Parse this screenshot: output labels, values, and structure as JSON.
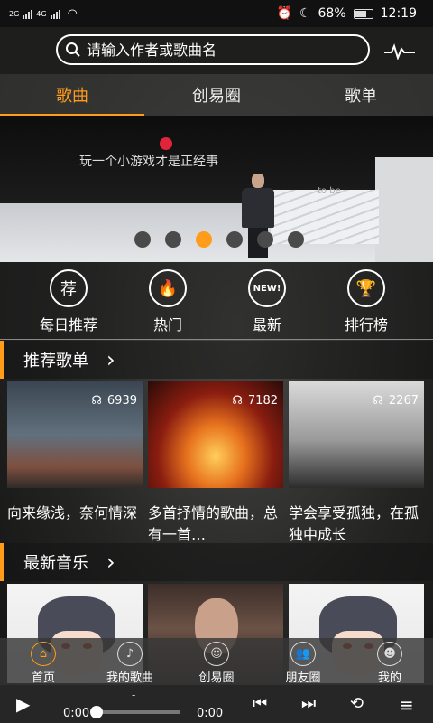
{
  "status": {
    "network_1": "2G",
    "network_2": "4G",
    "battery": "68%",
    "time": "12:19"
  },
  "search": {
    "placeholder": "请输入作者或歌曲名"
  },
  "tabs": [
    {
      "label": "歌曲",
      "active": true
    },
    {
      "label": "创易圈",
      "active": false
    },
    {
      "label": "歌单",
      "active": false
    }
  ],
  "banner": {
    "slogan": "玩一个小游戏才是正经事",
    "brand": "to be",
    "active_page": 3,
    "page_count": 6
  },
  "quick_actions": [
    {
      "label": "每日推荐",
      "icon": "recommend-icon",
      "glyph": "荐"
    },
    {
      "label": "热门",
      "icon": "flame-icon",
      "glyph": "🔥"
    },
    {
      "label": "最新",
      "icon": "new-badge-icon",
      "glyph": "NEW!"
    },
    {
      "label": "排行榜",
      "icon": "trophy-icon",
      "glyph": "🏆"
    }
  ],
  "recommended": {
    "title": "推荐歌单",
    "items": [
      {
        "title": "向来缘浅，奈何情深",
        "plays": "6939"
      },
      {
        "title": "多首抒情的歌曲，总有一首…",
        "plays": "7182"
      },
      {
        "title": "学会享受孤独，在孤独中成长",
        "plays": "2267"
      }
    ]
  },
  "latest": {
    "title": "最新音乐"
  },
  "bottom_nav": [
    {
      "label": "首页",
      "icon": "home-icon",
      "glyph": "⌂",
      "active": true
    },
    {
      "label": "我的歌曲",
      "icon": "music-note-icon",
      "glyph": "♪",
      "active": false
    },
    {
      "label": "创易圈",
      "icon": "smile-bot-icon",
      "glyph": "☺",
      "active": false
    },
    {
      "label": "朋友圈",
      "icon": "friends-icon",
      "glyph": "👥",
      "active": false
    },
    {
      "label": "我的",
      "icon": "user-icon",
      "glyph": "☻",
      "active": false
    }
  ],
  "player": {
    "current_time": "0:00",
    "total_time": "0:00",
    "title": "-",
    "progress": 0
  },
  "colors": {
    "accent": "#ff9c1a"
  }
}
